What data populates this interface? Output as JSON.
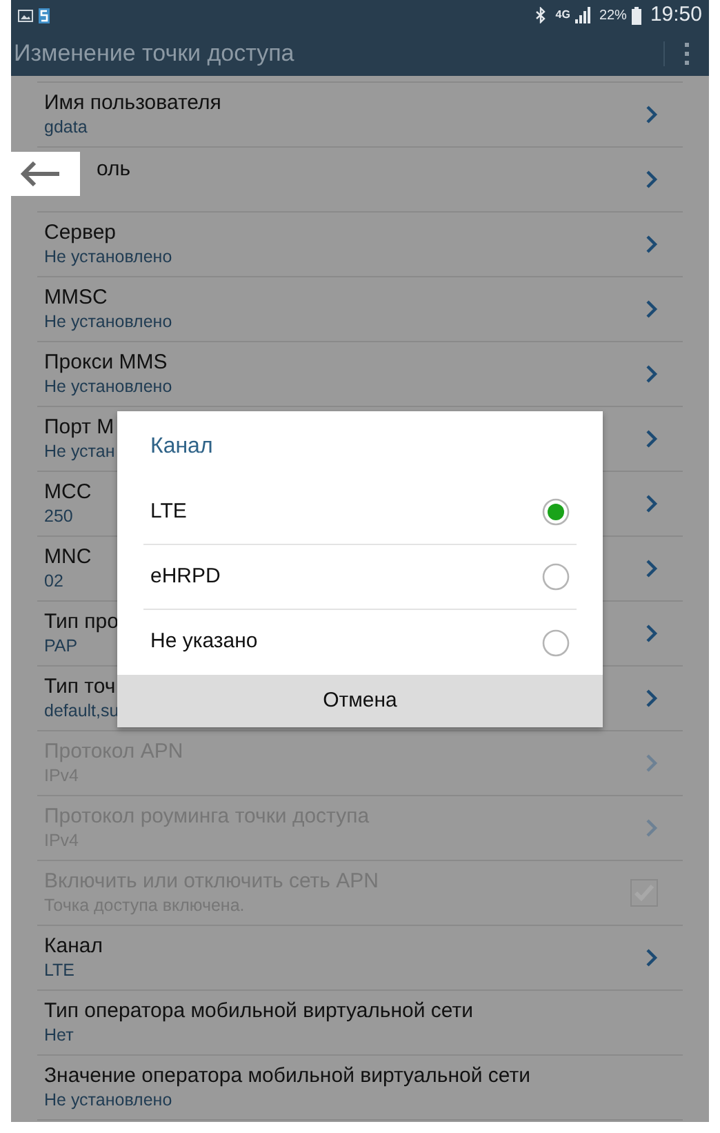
{
  "status_bar": {
    "battery": "22%",
    "network": "4G",
    "time": "19:50"
  },
  "app_bar": {
    "title": "Изменение точки доступа"
  },
  "settings": [
    {
      "kind": "link",
      "title": "Имя пользователя",
      "value": "gdata",
      "disabled": false
    },
    {
      "kind": "link",
      "title": "оль",
      "disabled": false
    },
    {
      "kind": "link",
      "title": "Сервер",
      "value": "Не установлено",
      "disabled": false
    },
    {
      "kind": "link",
      "title": "MMSC",
      "value": "Не установлено",
      "disabled": false
    },
    {
      "kind": "link",
      "title": "Прокси MMS",
      "value": "Не установлено",
      "disabled": false
    },
    {
      "kind": "link",
      "title": "Порт M",
      "value": "Не устан",
      "disabled": false
    },
    {
      "kind": "link",
      "title": "MCC",
      "value": "250",
      "disabled": false
    },
    {
      "kind": "link",
      "title": "MNC",
      "value": "02",
      "disabled": false
    },
    {
      "kind": "link",
      "title": "Тип про",
      "value": "PAP",
      "disabled": false
    },
    {
      "kind": "link",
      "title": "Тип точ",
      "value": "default,su",
      "disabled": false
    },
    {
      "kind": "link",
      "title": "Протокол APN",
      "value": "IPv4",
      "disabled": true
    },
    {
      "kind": "link",
      "title": "Протокол роуминга точки доступа",
      "value": "IPv4",
      "disabled": true
    },
    {
      "kind": "checkbox",
      "title": "Включить или отключить сеть APN",
      "value": "Точка доступа включена.",
      "disabled": true,
      "checked": true
    },
    {
      "kind": "link",
      "title": "Канал",
      "value": "LTE",
      "disabled": false
    },
    {
      "kind": "plain",
      "title": "Тип оператора мобильной виртуальной сети",
      "value": "Нет",
      "disabled": false
    },
    {
      "kind": "plain",
      "title": "Значение оператора мобильной виртуальной сети",
      "value": "Не установлено",
      "disabled": false
    }
  ],
  "dialog": {
    "title": "Канал",
    "options": [
      {
        "label": "LTE",
        "selected": true
      },
      {
        "label": "eHRPD",
        "selected": false
      },
      {
        "label": "Не указано",
        "selected": false
      }
    ],
    "cancel": "Отмена"
  }
}
